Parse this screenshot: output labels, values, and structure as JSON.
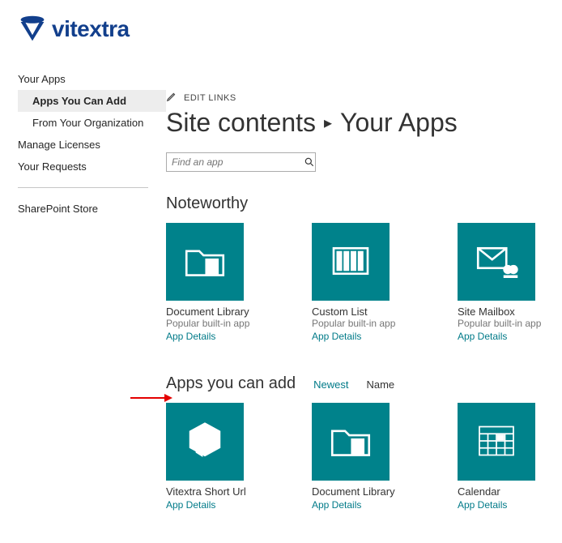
{
  "brand": {
    "name": "vitextra"
  },
  "header": {
    "edit_links": "EDIT LINKS",
    "breadcrumb": {
      "parent": "Site contents",
      "current": "Your Apps"
    }
  },
  "sidebar": {
    "items": [
      {
        "label": "Your Apps"
      },
      {
        "label": "Apps You Can Add"
      },
      {
        "label": "From Your Organization"
      },
      {
        "label": "Manage Licenses"
      },
      {
        "label": "Your Requests"
      },
      {
        "label": "SharePoint Store"
      }
    ]
  },
  "search": {
    "placeholder": "Find an app"
  },
  "sections": {
    "noteworthy": {
      "title": "Noteworthy"
    },
    "can_add": {
      "title": "Apps you can add",
      "sort": {
        "newest": "Newest",
        "name": "Name"
      }
    }
  },
  "common": {
    "popular": "Popular built-in app",
    "details": "App Details"
  },
  "noteworthy_apps": [
    {
      "title": "Document Library",
      "icon": "folder-doc"
    },
    {
      "title": "Custom List",
      "icon": "columns"
    },
    {
      "title": "Site Mailbox",
      "icon": "mailbox"
    }
  ],
  "addable_apps": [
    {
      "title": "Vitextra Short Url",
      "icon": "cube"
    },
    {
      "title": "Document Library",
      "icon": "folder-doc"
    },
    {
      "title": "Calendar",
      "icon": "calendar"
    }
  ]
}
